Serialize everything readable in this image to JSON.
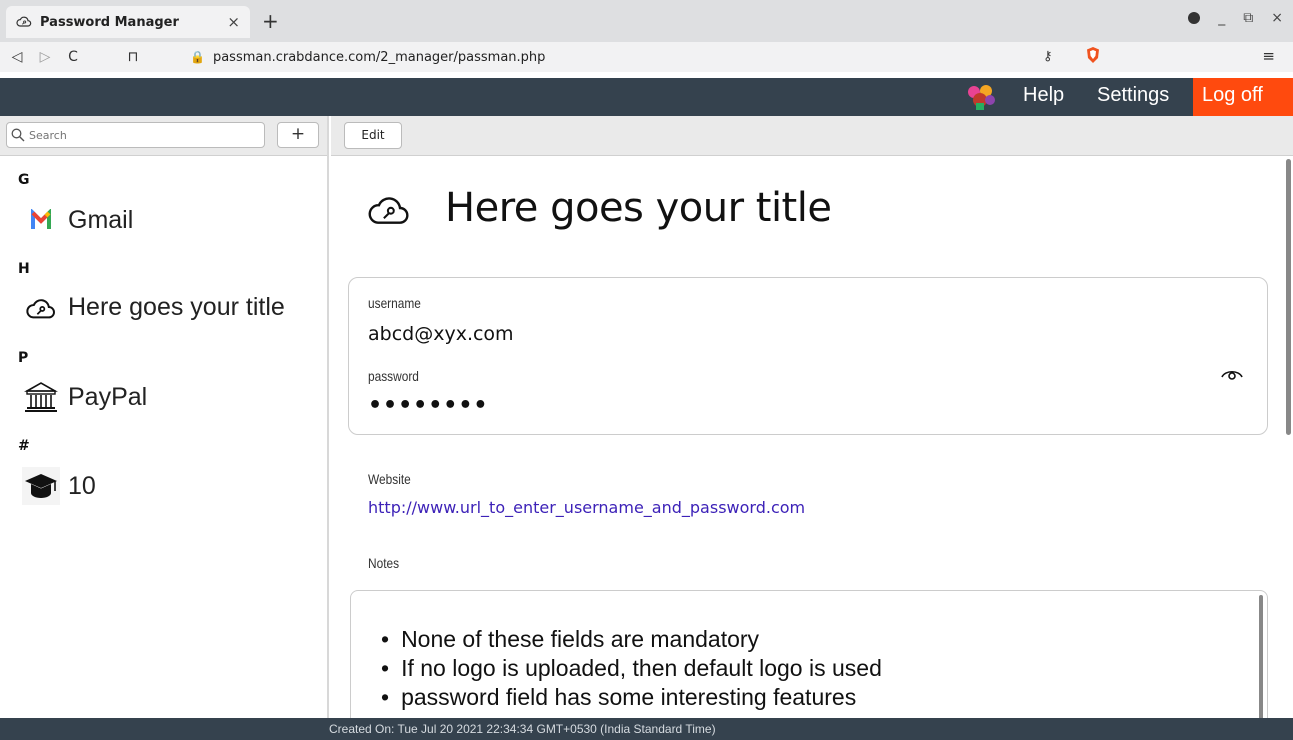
{
  "browser": {
    "tab_title": "Password Manager",
    "tab_close": "×",
    "new_tab": "+",
    "url": "passman.crabdance.com/2_manager/passman.php",
    "back": "◁",
    "forward": "▷",
    "reload": "C",
    "bookmark": "⊓",
    "menu": "≡",
    "win_minimize": "_",
    "win_restore": "⧉",
    "win_close": "×"
  },
  "appbar": {
    "help": "Help",
    "settings": "Settings",
    "logoff": "Log off"
  },
  "sidebar": {
    "search_placeholder": "Search",
    "add_label": "+",
    "groups": [
      {
        "letter": "G",
        "item": "Gmail",
        "icon": "gmail-icon"
      },
      {
        "letter": "H",
        "item": "Here goes your title",
        "icon": "cloud-key-icon"
      },
      {
        "letter": "P",
        "item": "PayPal",
        "icon": "bank-icon"
      },
      {
        "letter": "#",
        "item": "10",
        "icon": "graduation-cap-icon"
      }
    ]
  },
  "main": {
    "edit_label": "Edit",
    "title": "Here goes your title",
    "username_label": "username",
    "username_value": "abcd@xyx.com",
    "password_label": "password",
    "password_mask": "••••••••",
    "website_label": "Website",
    "website_url": "http://www.url_to_enter_username_and_password.com",
    "notes_label": "Notes",
    "notes": [
      "None of these fields are mandatory",
      "If no logo is uploaded, then default logo is used",
      "password field has some interesting features"
    ]
  },
  "footer": {
    "created": "Created On: Tue Jul 20 2021 22:34:34 GMT+0530 (India Standard Time)"
  },
  "colors": {
    "appbar_bg": "#35424e",
    "logoff_bg": "#ff4a0e",
    "link": "#3d22b8"
  }
}
